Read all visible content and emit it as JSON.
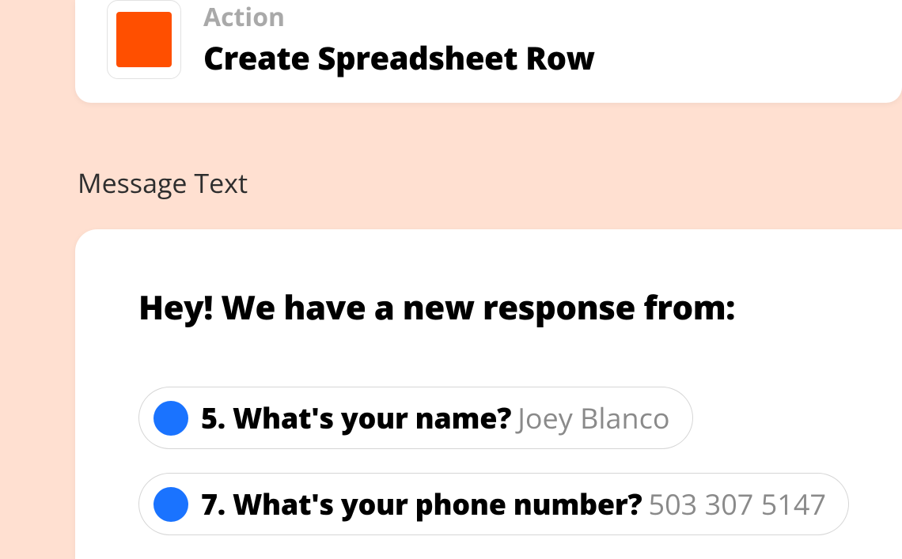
{
  "action": {
    "label": "Action",
    "name": "Create Spreadsheet Row",
    "icon_color": "#ff4f00"
  },
  "section": {
    "label": "Message Text"
  },
  "message": {
    "heading": "Hey! We have a new response from:",
    "chips": [
      {
        "question": "5. What's your name?",
        "answer": "Joey Blanco"
      },
      {
        "question": "7. What's your phone number?",
        "answer": "503 307 5147"
      }
    ]
  }
}
